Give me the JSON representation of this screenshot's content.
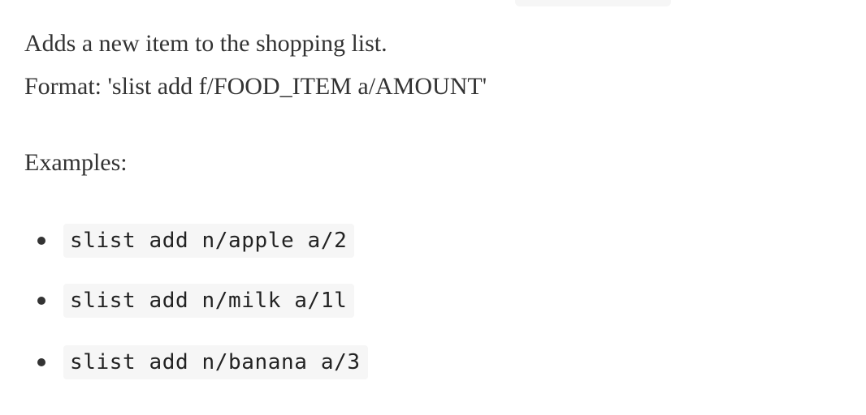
{
  "description": "Adds a new item to the shopping list.",
  "format": "Format: 'slist add f/FOOD_ITEM a/AMOUNT'",
  "examples_label": "Examples:",
  "examples": [
    "slist add n/apple a/2",
    "slist add n/milk a/1l",
    "slist add n/banana a/3"
  ],
  "colors": {
    "heading_accent": "#e8742a",
    "text": "#333333",
    "code_background": "#f6f6f6"
  }
}
